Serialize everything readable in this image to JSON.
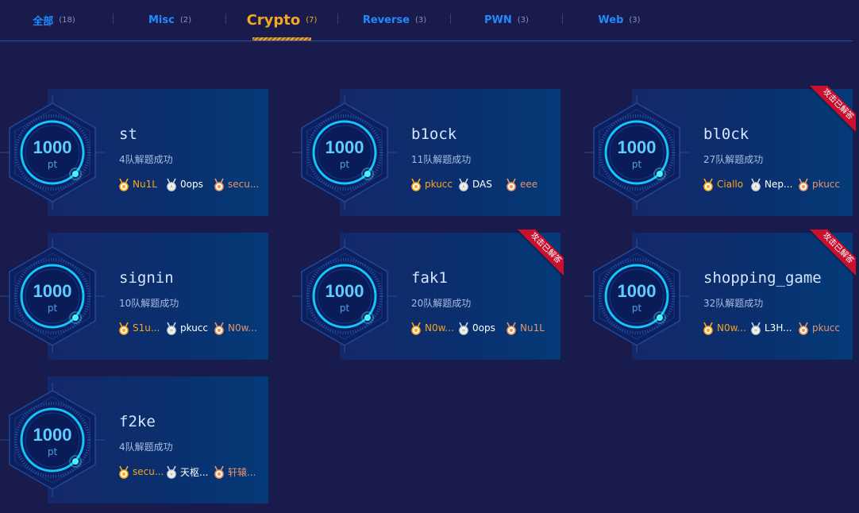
{
  "tabs": [
    {
      "label": "全部",
      "count": "(18)",
      "active": false
    },
    {
      "label": "Misc",
      "count": "(2)",
      "active": false
    },
    {
      "label": "Crypto",
      "count": "(7)",
      "active": true
    },
    {
      "label": "Reverse",
      "count": "(3)",
      "active": false
    },
    {
      "label": "PWN",
      "count": "(3)",
      "active": false
    },
    {
      "label": "Web",
      "count": "(3)",
      "active": false
    }
  ],
  "ribbon_label": "攻击已解答",
  "colors": {
    "accent": "#f5a623",
    "tab_link": "#1f8bff",
    "ribbon": "#c8102e",
    "points": "#5fcdff"
  },
  "challenges": [
    {
      "name": "st",
      "points": "1000",
      "unit": "pt",
      "solved": "4队解题成功",
      "solved_by_me": false,
      "teams": [
        {
          "rank": "gold",
          "name": "Nu1L"
        },
        {
          "rank": "silver",
          "name": "0ops"
        },
        {
          "rank": "bronze",
          "name": "secu..."
        }
      ]
    },
    {
      "name": "b1ock",
      "points": "1000",
      "unit": "pt",
      "solved": "11队解题成功",
      "solved_by_me": false,
      "teams": [
        {
          "rank": "gold",
          "name": "pkucc"
        },
        {
          "rank": "silver",
          "name": "DAS"
        },
        {
          "rank": "bronze",
          "name": "eee"
        }
      ]
    },
    {
      "name": "bl0ck",
      "points": "1000",
      "unit": "pt",
      "solved": "27队解题成功",
      "solved_by_me": true,
      "teams": [
        {
          "rank": "gold",
          "name": "Ciallo"
        },
        {
          "rank": "silver",
          "name": "Nep..."
        },
        {
          "rank": "bronze",
          "name": "pkucc"
        }
      ]
    },
    {
      "name": "signin",
      "points": "1000",
      "unit": "pt",
      "solved": "10队解题成功",
      "solved_by_me": false,
      "teams": [
        {
          "rank": "gold",
          "name": "S1u..."
        },
        {
          "rank": "silver",
          "name": "pkucc"
        },
        {
          "rank": "bronze",
          "name": "N0w..."
        }
      ]
    },
    {
      "name": "fak1",
      "points": "1000",
      "unit": "pt",
      "solved": "20队解题成功",
      "solved_by_me": true,
      "teams": [
        {
          "rank": "gold",
          "name": "N0w..."
        },
        {
          "rank": "silver",
          "name": "0ops"
        },
        {
          "rank": "bronze",
          "name": "Nu1L"
        }
      ]
    },
    {
      "name": "shopping_game",
      "points": "1000",
      "unit": "pt",
      "solved": "32队解题成功",
      "solved_by_me": true,
      "teams": [
        {
          "rank": "gold",
          "name": "N0w..."
        },
        {
          "rank": "silver",
          "name": "L3H..."
        },
        {
          "rank": "bronze",
          "name": "pkucc"
        }
      ]
    },
    {
      "name": "f2ke",
      "points": "1000",
      "unit": "pt",
      "solved": "4队解题成功",
      "solved_by_me": false,
      "teams": [
        {
          "rank": "gold",
          "name": "secu..."
        },
        {
          "rank": "silver",
          "name": "天枢..."
        },
        {
          "rank": "bronze",
          "name": "轩辕..."
        }
      ]
    }
  ]
}
